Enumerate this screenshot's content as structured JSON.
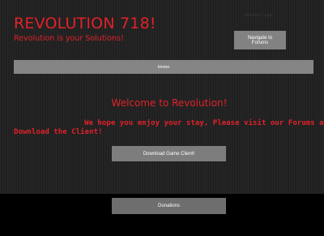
{
  "header": {
    "title": "REVOLUTION 718!",
    "tagline": "Revolution is your Solutions!",
    "members_link": "Members Login",
    "forums_button": "Navigate to Forums"
  },
  "nav": {
    "home_label": "Home"
  },
  "main": {
    "welcome": "Welcome to Revolution!",
    "message_line1": "We hope you enjoy your stay, Please visit our Forums and",
    "message_line2": "Download the Client!",
    "download_button": "Download Game Client!"
  },
  "footer": {
    "donations_button": "Donations"
  },
  "colors": {
    "accent": "#e0222a",
    "background": "#222222",
    "button": "#7d7d7d",
    "footer": "#000000"
  }
}
